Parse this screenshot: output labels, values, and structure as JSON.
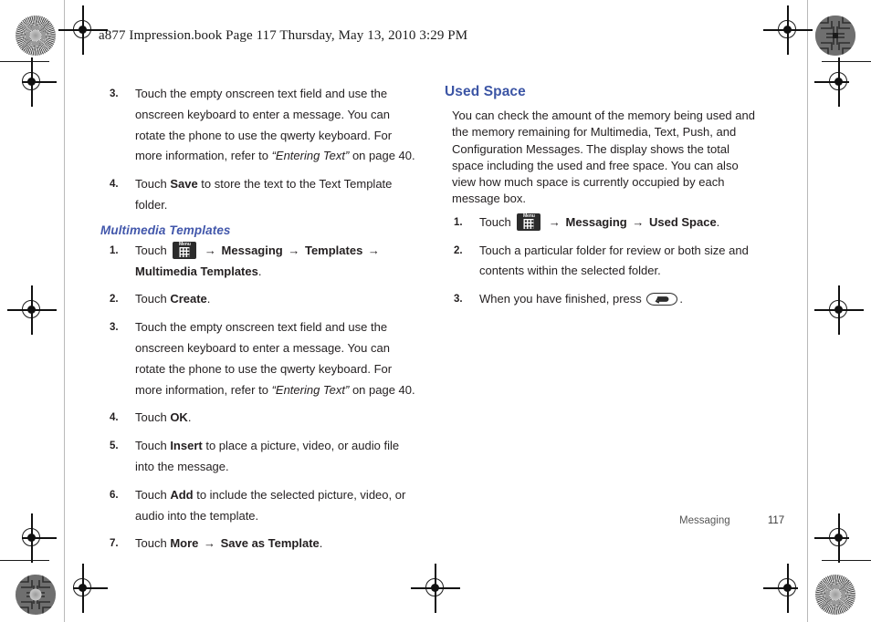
{
  "header": {
    "text": "a877 Impression.book  Page 117  Thursday, May 13, 2010  3:29 PM"
  },
  "icons": {
    "menu_key_label": "Menu",
    "arrow": "→"
  },
  "left_column": {
    "continued_steps": [
      {
        "num": "3.",
        "parts": [
          {
            "t": "Touch the empty onscreen text field and use the onscreen keyboard to enter a message. You can rotate the phone to use the qwerty keyboard. For more information, refer to ",
            "style": "normal"
          },
          {
            "t": "“Entering Text”",
            "style": "italic"
          },
          {
            "t": "  on page 40.",
            "style": "normal"
          }
        ]
      },
      {
        "num": "4.",
        "parts": [
          {
            "t": "Touch ",
            "style": "normal"
          },
          {
            "t": "Save",
            "style": "bold"
          },
          {
            "t": " to store the text to the Text Template folder.",
            "style": "normal"
          }
        ]
      }
    ],
    "subheading": "Multimedia Templates",
    "steps": [
      {
        "num": "1.",
        "parts": [
          {
            "t": "Touch ",
            "style": "normal"
          },
          {
            "t": "menu-key-icon",
            "style": "menu-icon"
          },
          {
            "t": " → ",
            "style": "arrow"
          },
          {
            "t": "Messaging",
            "style": "bold"
          },
          {
            "t": " → ",
            "style": "arrow"
          },
          {
            "t": "Templates",
            "style": "bold"
          },
          {
            "t": " → ",
            "style": "arrow"
          },
          {
            "t": "Multimedia Templates",
            "style": "bold"
          },
          {
            "t": ".",
            "style": "normal"
          }
        ]
      },
      {
        "num": "2.",
        "parts": [
          {
            "t": "Touch ",
            "style": "normal"
          },
          {
            "t": "Create",
            "style": "bold"
          },
          {
            "t": ".",
            "style": "normal"
          }
        ]
      },
      {
        "num": "3.",
        "parts": [
          {
            "t": "Touch the empty onscreen text field and use the onscreen keyboard to enter a message. You can rotate the phone to use the qwerty keyboard. For more information, refer to ",
            "style": "normal"
          },
          {
            "t": "“Entering Text”",
            "style": "italic"
          },
          {
            "t": "  on page 40.",
            "style": "normal"
          }
        ]
      },
      {
        "num": "4.",
        "parts": [
          {
            "t": "Touch ",
            "style": "normal"
          },
          {
            "t": "OK",
            "style": "bold"
          },
          {
            "t": ".",
            "style": "normal"
          }
        ]
      },
      {
        "num": "5.",
        "parts": [
          {
            "t": "Touch ",
            "style": "normal"
          },
          {
            "t": "Insert",
            "style": "bold"
          },
          {
            "t": " to place a picture, video, or audio file into the message.",
            "style": "normal"
          }
        ]
      },
      {
        "num": "6.",
        "parts": [
          {
            "t": "Touch ",
            "style": "normal"
          },
          {
            "t": "Add",
            "style": "bold"
          },
          {
            "t": " to include the selected picture, video, or audio into the template.",
            "style": "normal"
          }
        ]
      },
      {
        "num": "7.",
        "parts": [
          {
            "t": "Touch ",
            "style": "normal"
          },
          {
            "t": "More",
            "style": "bold"
          },
          {
            "t": " → ",
            "style": "arrow-bold"
          },
          {
            "t": "Save as Template",
            "style": "bold"
          },
          {
            "t": ".",
            "style": "normal"
          }
        ]
      }
    ]
  },
  "right_column": {
    "heading": "Used Space",
    "paragraph": "You can check the amount of the memory being used and the memory remaining for Multimedia, Text, Push, and Configuration Messages. The display shows the total space including the used and free space. You can also view how much space is currently occupied by each message box.",
    "steps": [
      {
        "num": "1.",
        "parts": [
          {
            "t": "Touch ",
            "style": "normal"
          },
          {
            "t": "menu-key-icon",
            "style": "menu-icon"
          },
          {
            "t": " → ",
            "style": "arrow"
          },
          {
            "t": "Messaging",
            "style": "bold"
          },
          {
            "t": " → ",
            "style": "arrow"
          },
          {
            "t": "Used Space",
            "style": "bold"
          },
          {
            "t": ".",
            "style": "normal"
          }
        ]
      },
      {
        "num": "2.",
        "parts": [
          {
            "t": "Touch a particular folder for review or both size and contents within the selected folder.",
            "style": "normal"
          }
        ]
      },
      {
        "num": "3.",
        "parts": [
          {
            "t": "When you have finished, press ",
            "style": "normal"
          },
          {
            "t": "back-key-icon",
            "style": "back-icon"
          },
          {
            "t": ".",
            "style": "normal"
          }
        ]
      }
    ]
  },
  "footer": {
    "chapter": "Messaging",
    "page_number": "117"
  },
  "colors": {
    "heading_blue": "#3c55a5",
    "subheading_blue": "#4257ab",
    "body_text": "#231f20",
    "footer_text": "#555555"
  }
}
